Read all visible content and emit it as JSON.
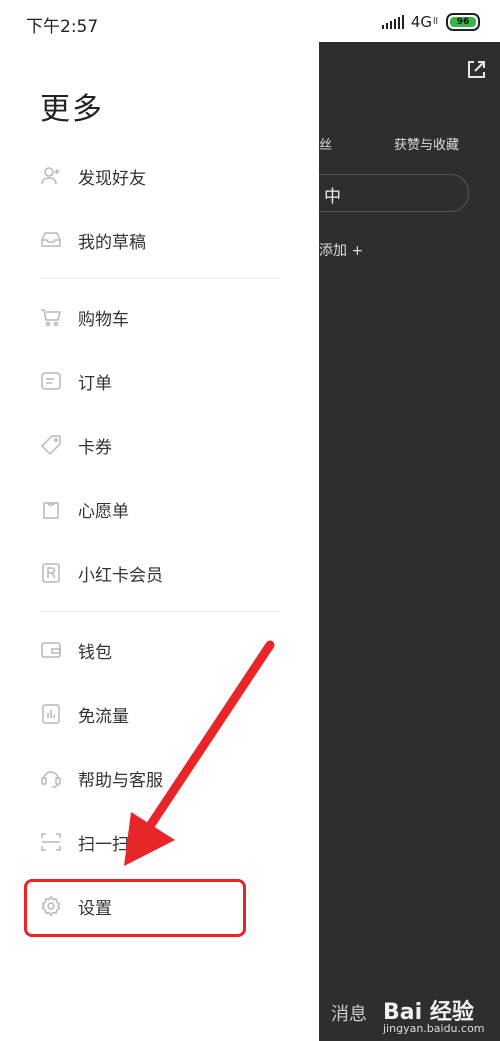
{
  "status_bar": {
    "time": "下午2:57",
    "network": "4G",
    "network_sub": "ll",
    "battery": "96"
  },
  "drawer": {
    "title": "更多",
    "groups": [
      [
        {
          "label": "发现好友",
          "icon": "add-friend-icon"
        },
        {
          "label": "我的草稿",
          "icon": "drafts-icon"
        }
      ],
      [
        {
          "label": "购物车",
          "icon": "cart-icon"
        },
        {
          "label": "订单",
          "icon": "order-icon"
        },
        {
          "label": "卡券",
          "icon": "coupon-icon"
        },
        {
          "label": "心愿单",
          "icon": "wishlist-icon"
        },
        {
          "label": "小红卡会员",
          "icon": "membership-icon"
        }
      ],
      [
        {
          "label": "钱包",
          "icon": "wallet-icon"
        },
        {
          "label": "免流量",
          "icon": "data-free-icon"
        },
        {
          "label": "帮助与客服",
          "icon": "customer-service-icon"
        },
        {
          "label": "扫一扫",
          "icon": "scan-icon"
        },
        {
          "label": "设置",
          "icon": "gear-icon"
        }
      ]
    ]
  },
  "background_app": {
    "tab_partial": "丝",
    "tab_likes": "获赞与收藏",
    "pill_text": "中",
    "add_text": "添加 +",
    "messages": "消息",
    "watermark_brand": "Bai 经验",
    "watermark_url": "jingyan.baidu.com"
  },
  "annotation": {
    "box_color": "#e8262a",
    "arrow_color": "#e8262a"
  }
}
